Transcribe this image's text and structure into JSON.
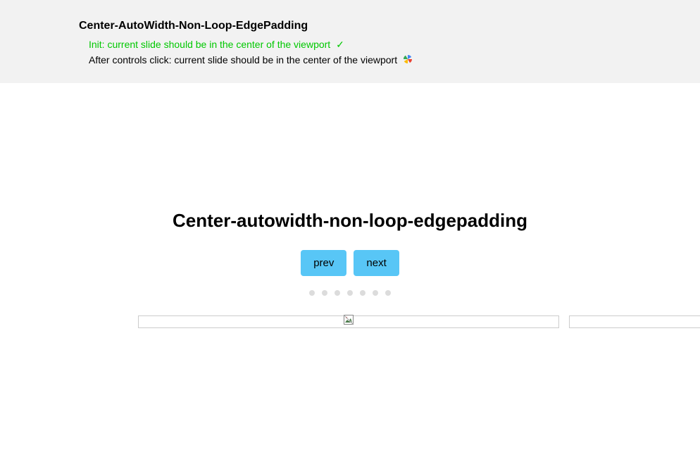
{
  "header": {
    "title": "Center-AutoWidth-Non-Loop-EdgePadding",
    "status_pass": "Init: current slide should be in the center of the viewport",
    "status_running": "After controls click: current slide should be in the center of the viewport"
  },
  "main": {
    "title": "Center-autowidth-non-loop-edgepadding",
    "prev_label": "prev",
    "next_label": "next",
    "dot_count": 7
  }
}
